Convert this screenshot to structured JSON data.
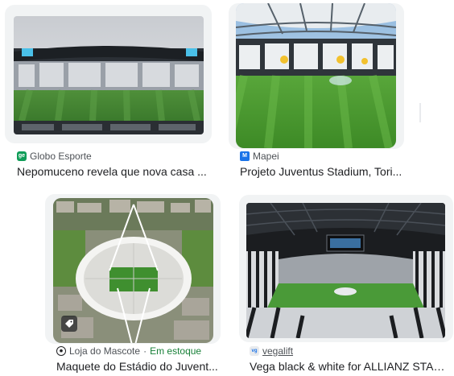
{
  "results": [
    {
      "source": "Globo Esporte",
      "title": "Nepomuceno revela que nova casa ...",
      "favicon": "ge-favicon",
      "favicon_color": "#0f9d58"
    },
    {
      "source": "Mapei",
      "title": "Projeto Juventus Stadium, Tori...",
      "favicon": "mapei-favicon",
      "favicon_color": "#1a73e8"
    },
    {
      "source": "Loja do Mascote",
      "availability": "Em estoque",
      "separator": "·",
      "title": "Maquete do Estádio do Juvent...",
      "favicon": "soccer-ball-favicon",
      "badge_icon": "price-tag-icon"
    },
    {
      "source": "vegalift",
      "title": "Vega black & white for ALLIANZ STAD...",
      "favicon": "vegalift-favicon"
    }
  ],
  "colors": {
    "text": "#202124",
    "source_text": "#4d5156",
    "in_stock": "#188038",
    "pitch_green": "#3f8f2f"
  }
}
